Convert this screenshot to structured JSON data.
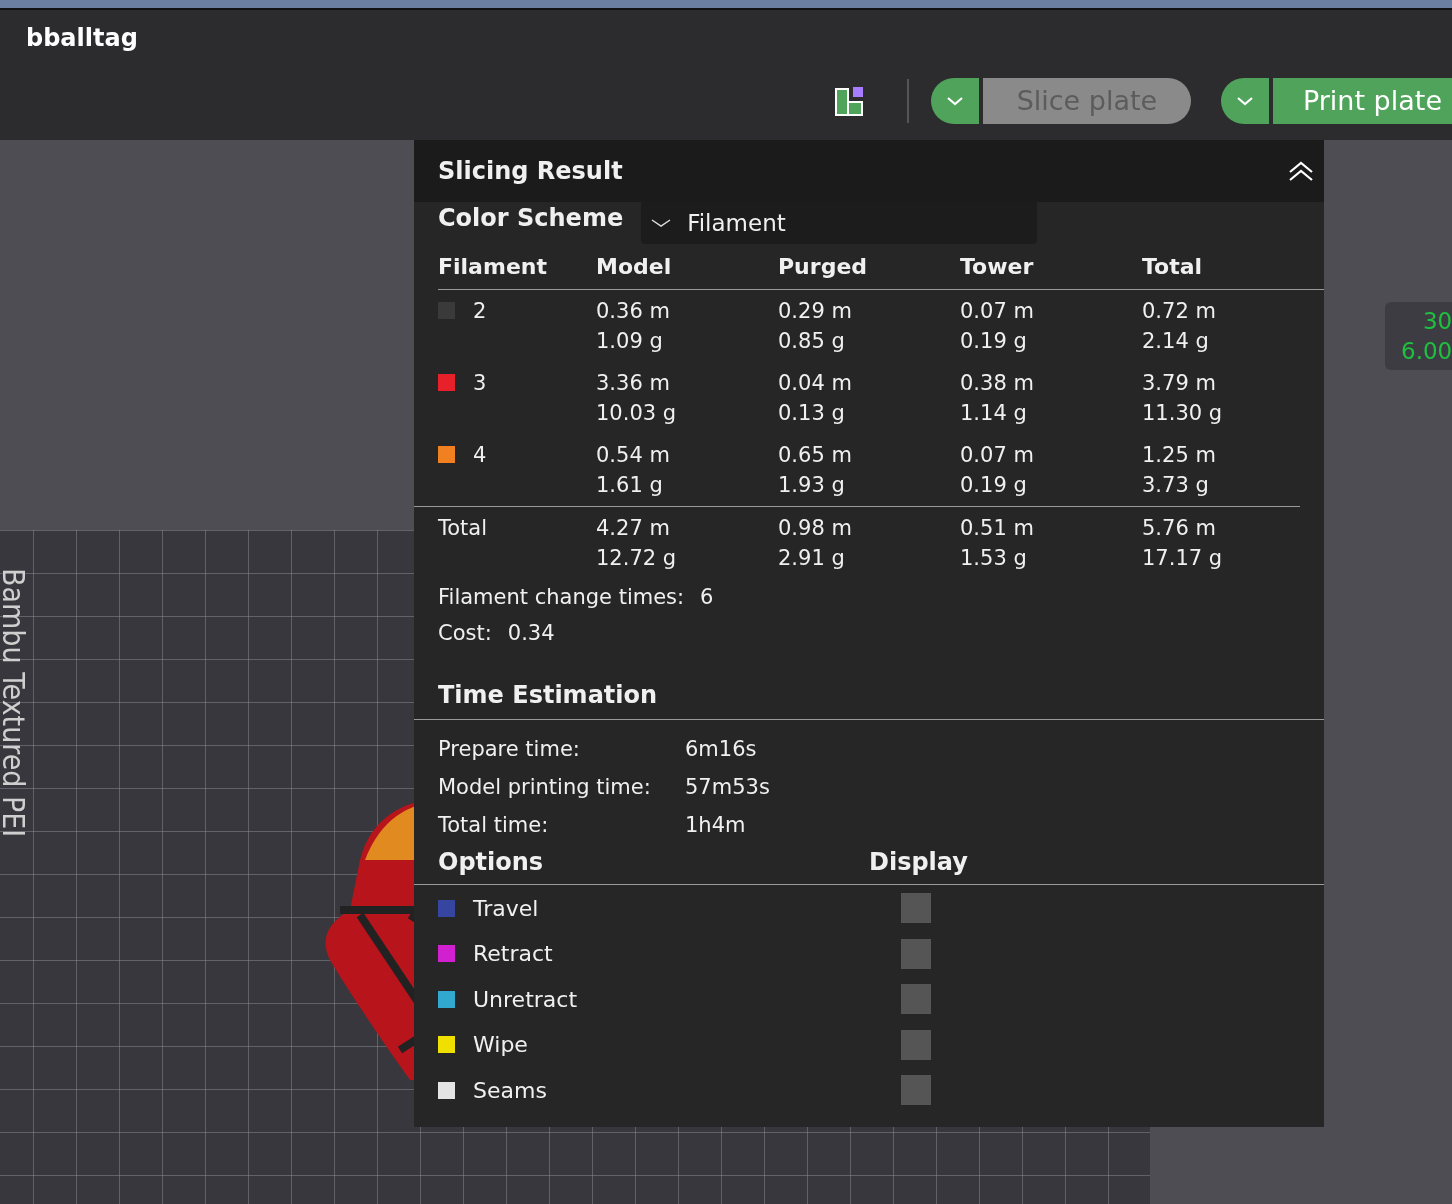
{
  "window": {
    "title": "bballtag"
  },
  "toolbar": {
    "buttons": [
      {
        "label": "Slice plate",
        "disabled": true
      },
      {
        "label": "Print plate",
        "disabled": false
      }
    ]
  },
  "viewport": {
    "plate_label": "Bambu Textured PEI",
    "layer_scale": [
      "30",
      "6.00"
    ]
  },
  "slicing_result": {
    "title": "Slicing Result",
    "color_scheme": {
      "label": "Color Scheme",
      "value": "Filament"
    },
    "columns": [
      "Filament",
      "Model",
      "Purged",
      "Tower",
      "Total"
    ],
    "rows": [
      {
        "filament": "2",
        "color": "#3a3a3a",
        "model": [
          "0.36 m",
          "1.09 g"
        ],
        "purged": [
          "0.29 m",
          "0.85 g"
        ],
        "tower": [
          "0.07 m",
          "0.19 g"
        ],
        "total": [
          "0.72 m",
          "2.14 g"
        ]
      },
      {
        "filament": "3",
        "color": "#e8202a",
        "model": [
          "3.36 m",
          "10.03 g"
        ],
        "purged": [
          "0.04 m",
          "0.13 g"
        ],
        "tower": [
          "0.38 m",
          "1.14 g"
        ],
        "total": [
          "3.79 m",
          "11.30 g"
        ]
      },
      {
        "filament": "4",
        "color": "#f08020",
        "model": [
          "0.54 m",
          "1.61 g"
        ],
        "purged": [
          "0.65 m",
          "1.93 g"
        ],
        "tower": [
          "0.07 m",
          "0.19 g"
        ],
        "total": [
          "1.25 m",
          "3.73 g"
        ]
      }
    ],
    "total": {
      "filament": "Total",
      "model": [
        "4.27 m",
        "12.72 g"
      ],
      "purged": [
        "0.98 m",
        "2.91 g"
      ],
      "tower": [
        "0.51 m",
        "1.53 g"
      ],
      "total": [
        "5.76 m",
        "17.17 g"
      ]
    },
    "change_times": {
      "label": "Filament change times:",
      "value": "6"
    },
    "cost": {
      "label": "Cost:",
      "value": "0.34"
    }
  },
  "time_estimation": {
    "title": "Time Estimation",
    "items": [
      {
        "label": "Prepare time:",
        "value": "6m16s"
      },
      {
        "label": "Model printing time:",
        "value": "57m53s"
      },
      {
        "label": "Total time:",
        "value": "1h4m"
      }
    ]
  },
  "options": {
    "title": "Options",
    "display_title": "Display",
    "items": [
      {
        "label": "Travel",
        "color": "#3545a0",
        "checked": false
      },
      {
        "label": "Retract",
        "color": "#d020d0",
        "checked": false
      },
      {
        "label": "Unretract",
        "color": "#30a8d0",
        "checked": false
      },
      {
        "label": "Wipe",
        "color": "#f0e000",
        "checked": false
      },
      {
        "label": "Seams",
        "color": "#e4e4e4",
        "checked": false
      }
    ]
  }
}
